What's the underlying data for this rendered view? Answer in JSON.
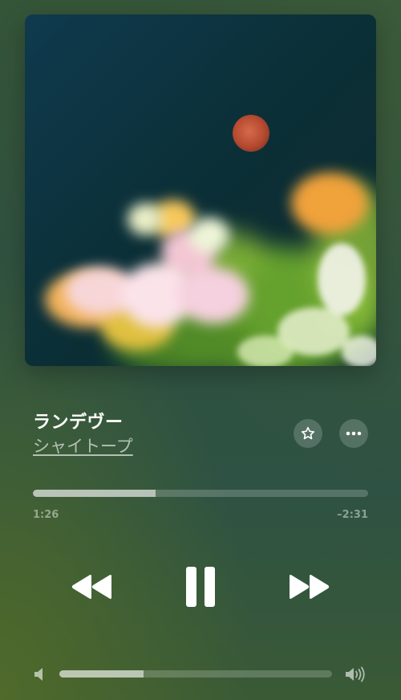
{
  "track": {
    "title": "ランデヴー",
    "artist": "シャイトープ"
  },
  "playback": {
    "elapsed": "1:26",
    "remaining": "–2:31",
    "progress_fraction": 0.366,
    "state": "playing"
  },
  "volume": {
    "level_fraction": 0.31
  },
  "icons": {
    "favorite": "star-icon",
    "more": "ellipsis-icon",
    "rewind": "rewind-icon",
    "pause": "pause-icon",
    "forward": "fast-forward-icon",
    "volume_low": "speaker-low-icon",
    "volume_high": "speaker-high-icon"
  },
  "colors": {
    "background": "#2f5140",
    "foreground": "#ffffff"
  }
}
